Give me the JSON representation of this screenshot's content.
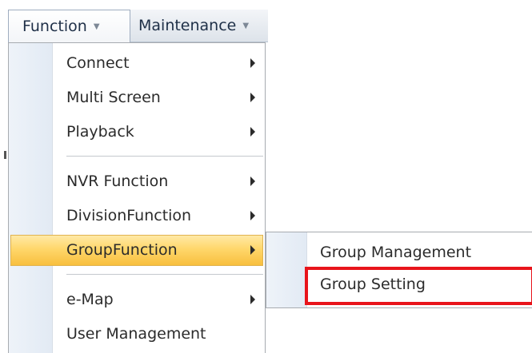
{
  "menubar": {
    "function_label": "Function",
    "maintenance_label": "Maintenance"
  },
  "function_menu": {
    "items": [
      {
        "label": "Connect",
        "has_submenu": true
      },
      {
        "label": "Multi Screen",
        "has_submenu": true
      },
      {
        "label": "Playback",
        "has_submenu": true
      },
      {
        "label": "NVR Function",
        "has_submenu": true
      },
      {
        "label": "DivisionFunction",
        "has_submenu": true
      },
      {
        "label": "GroupFunction",
        "has_submenu": true,
        "highlighted": true
      },
      {
        "label": "e-Map",
        "has_submenu": true
      },
      {
        "label": "User Management",
        "has_submenu": false
      }
    ]
  },
  "group_submenu": {
    "items": [
      {
        "label": "Group Management"
      },
      {
        "label": "Group Setting",
        "annotated": true
      }
    ]
  },
  "colors": {
    "highlight_gradient_top": "#ffe9a6",
    "highlight_gradient_bottom": "#f8bf3e",
    "annotation_red": "#e8141b"
  },
  "icons": {
    "dropdown_arrow": "chevron-down-icon",
    "submenu_arrow": "chevron-right-icon"
  }
}
